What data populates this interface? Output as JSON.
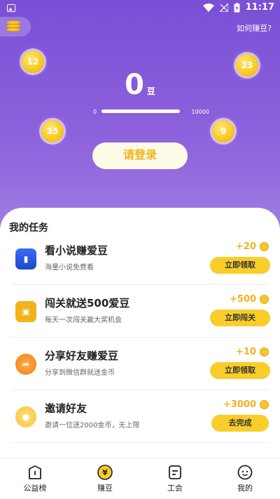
{
  "status": {
    "time": "11:17"
  },
  "header": {
    "how_link": "如何赚豆?"
  },
  "bubbles": [
    "12",
    "23",
    "35",
    "9"
  ],
  "balance": {
    "value": "0",
    "unit": "豆",
    "progress_min": "0",
    "progress_max": "10000",
    "progress_fraction": 0
  },
  "login_button": "请登录",
  "tasks_title": "我的任务",
  "tasks": [
    {
      "name": "看小说赚爱豆",
      "sub": "海量小说免费看",
      "reward": "+20",
      "button": "立即领取",
      "icon": "novel-icon"
    },
    {
      "name": "闯关就送500爱豆",
      "sub": "每天一次闯关赢大奖机会",
      "reward": "+500",
      "button": "立即闯关",
      "icon": "game-icon"
    },
    {
      "name": "分享好友赚爱豆",
      "sub": "分享到微信群就送金币",
      "reward": "+10",
      "button": "立即领取",
      "icon": "share-icon"
    },
    {
      "name": "邀请好友",
      "sub": "邀请一位送2000金币，无上限",
      "reward": "+3000",
      "button": "去完成",
      "icon": "invite-icon"
    }
  ],
  "nav": [
    {
      "label": "公益榜",
      "icon": "charity-icon"
    },
    {
      "label": "赚豆",
      "icon": "yen-coin-icon",
      "active": true
    },
    {
      "label": "工会",
      "icon": "guild-icon"
    },
    {
      "label": "我的",
      "icon": "profile-icon"
    }
  ],
  "colors": {
    "primary": "#7a4fd6",
    "accent": "#f9cd2a",
    "reward": "#f2b21e"
  }
}
